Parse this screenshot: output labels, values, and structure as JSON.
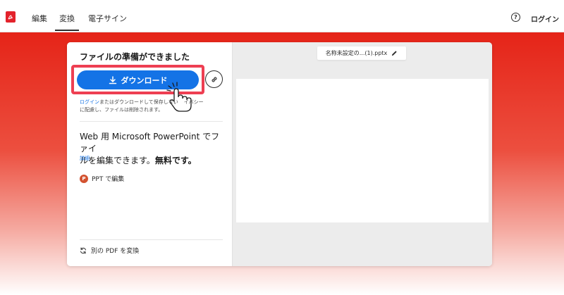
{
  "nav": {
    "tabs": [
      {
        "label": "編集",
        "active": false
      },
      {
        "label": "変換",
        "active": true
      },
      {
        "label": "電子サイン",
        "active": false
      }
    ],
    "help_symbol": "?",
    "login_label": "ログイン"
  },
  "panel": {
    "title": "ファイルの準備ができました",
    "download_label": "ダウンロード",
    "note_link": "ログイン",
    "note_line1_rest": "またはダウンロードして保存しない",
    "note_line1_tail": "イバシー",
    "note_line2": "に配慮し、ファイルは削除されます。",
    "promo_line1": "Web 用 Microsoft PowerPoint でファイ",
    "promo_line2_normal": "ルを編集できます。",
    "promo_line2_bold": "無料です。",
    "details_link": "詳細",
    "ppt_icon_letter": "P",
    "ppt_edit_label": "PPT で編集",
    "convert_label": "別の PDF を変換"
  },
  "preview": {
    "filename": "名称未設定の...(1).pptx"
  },
  "colors": {
    "accent": "#1473e6",
    "brand_red": "#e3222b",
    "highlight": "#ee3f52",
    "ppt": "#d35230"
  },
  "icons": [
    "acrobat-logo-icon",
    "help-icon",
    "download-icon",
    "link-icon",
    "pointer-hand-icon",
    "powerpoint-icon",
    "refresh-icon",
    "pencil-icon"
  ]
}
